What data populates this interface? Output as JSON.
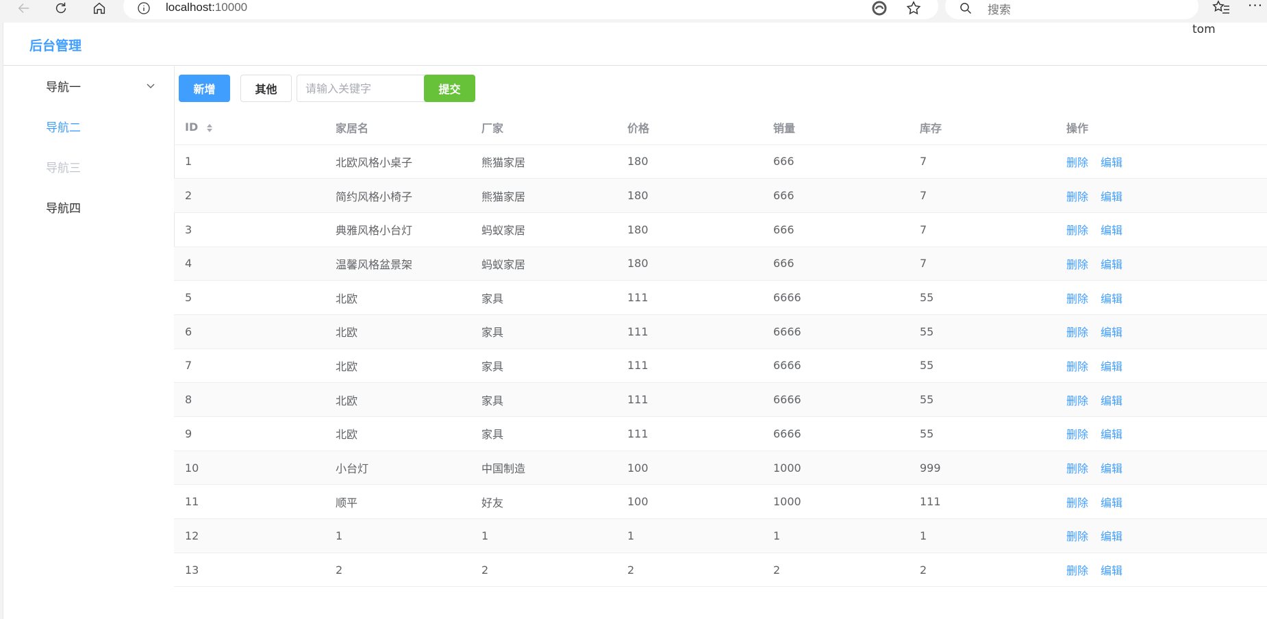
{
  "browser": {
    "url_host": "localhost:",
    "url_port": "10000",
    "search_placeholder": "搜索",
    "more": "···"
  },
  "app": {
    "title": "后台管理",
    "user": "tom"
  },
  "sidebar": {
    "items": [
      {
        "label": "导航一",
        "state": "expandable"
      },
      {
        "label": "导航二",
        "state": "active"
      },
      {
        "label": "导航三",
        "state": "disabled"
      },
      {
        "label": "导航四",
        "state": "normal"
      }
    ]
  },
  "toolbar": {
    "add_label": "新增",
    "other_label": "其他",
    "search_placeholder": "请输入关键字",
    "submit_label": "提交"
  },
  "table": {
    "headers": [
      "ID",
      "家居名",
      "厂家",
      "价格",
      "销量",
      "库存",
      "操作"
    ],
    "action_delete": "删除",
    "action_edit": "编辑",
    "rows": [
      [
        "1",
        "北欧风格小桌子",
        "熊猫家居",
        "180",
        "666",
        "7"
      ],
      [
        "2",
        "简约风格小椅子",
        "熊猫家居",
        "180",
        "666",
        "7"
      ],
      [
        "3",
        "典雅风格小台灯",
        "蚂蚁家居",
        "180",
        "666",
        "7"
      ],
      [
        "4",
        "温馨风格盆景架",
        "蚂蚁家居",
        "180",
        "666",
        "7"
      ],
      [
        "5",
        "北欧",
        "家具",
        "111",
        "6666",
        "55"
      ],
      [
        "6",
        "北欧",
        "家具",
        "111",
        "6666",
        "55"
      ],
      [
        "7",
        "北欧",
        "家具",
        "111",
        "6666",
        "55"
      ],
      [
        "8",
        "北欧",
        "家具",
        "111",
        "6666",
        "55"
      ],
      [
        "9",
        "北欧",
        "家具",
        "111",
        "6666",
        "55"
      ],
      [
        "10",
        "小台灯",
        "中国制造",
        "100",
        "1000",
        "999"
      ],
      [
        "11",
        "顺平",
        "好友",
        "100",
        "1000",
        "111"
      ],
      [
        "12",
        "1",
        "1",
        "1",
        "1",
        "1"
      ],
      [
        "13",
        "2",
        "2",
        "2",
        "2",
        "2"
      ]
    ]
  },
  "colors": {
    "primary": "#409eff",
    "success": "#67c23a",
    "disabled": "#c0c4cc"
  }
}
